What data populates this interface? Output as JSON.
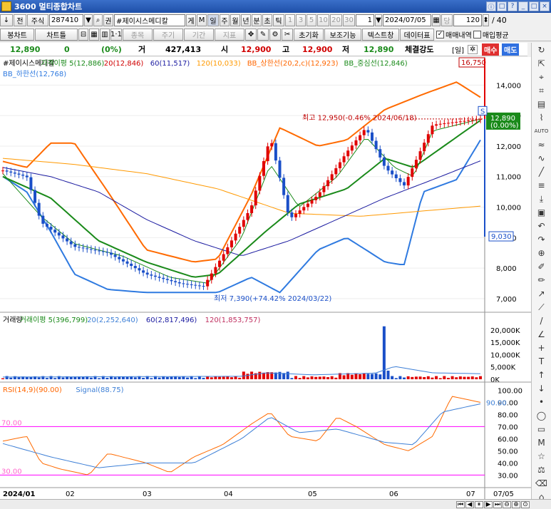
{
  "window": {
    "title": "3600 멀티종합차트",
    "controls": [
      "ⓘ",
      "□",
      "?",
      "_",
      "□",
      "×"
    ]
  },
  "toolbar1": {
    "items": [
      "↓",
      "전",
      "주식"
    ],
    "code": "287410",
    "name": "#제이시스메디칼",
    "markers": [
      "게",
      "M"
    ],
    "periods": [
      "일",
      "주",
      "월",
      "년",
      "분",
      "초",
      "틱"
    ],
    "minutes": [
      "1",
      "3",
      "5",
      "10",
      "20",
      "30"
    ],
    "interval": "1",
    "date": "2024/07/05",
    "dang": "당",
    "count": "120",
    "ratio": "/",
    "ratio2": "40"
  },
  "toolbar2": {
    "left": [
      "봉차트",
      "차트틀"
    ],
    "mid": [
      "종목",
      "주기",
      "기간",
      "지표"
    ],
    "right": [
      "초기화",
      "보조기능",
      "텍스트창",
      "데이터표"
    ],
    "checks": [
      {
        "label": "매매내역",
        "checked": true
      },
      {
        "label": "매입평균",
        "checked": false
      }
    ]
  },
  "quote": {
    "price": "12,890",
    "change": "0",
    "pct": "(0%)",
    "vol_label": "거",
    "volume": "427,413",
    "open_label": "시",
    "open": "12,900",
    "high_label": "고",
    "high": "12,900",
    "low_label": "저",
    "low": "12,890",
    "strength_label": "체결강도",
    "period_btn": "[일]",
    "buy": "매수",
    "sell": "매도"
  },
  "price_panel": {
    "legend": [
      {
        "text": "#제이시스메디칼",
        "color": "#000000"
      },
      {
        "text": "가격이평 5(12,886)",
        "color": "#1a8a1a"
      },
      {
        "text": "20(12,846)",
        "color": "#d00000"
      },
      {
        "text": "60(11,517)",
        "color": "#1a1aa0"
      },
      {
        "text": "120(10,033)",
        "color": "#ff9900"
      },
      {
        "text": "BB_상한선(20,2,c)(12,923)",
        "color": "#ff6600"
      },
      {
        "text": "BB_중심선(12,846)",
        "color": "#1a8a1a"
      }
    ],
    "legend2": "BB_하한선(12,768)",
    "high_note": "최고 12,950(-0.46% 2024/06/18)",
    "low_note": "최저 7,390(+74.42% 2024/03/22)",
    "y_ticks": [
      "14,000",
      "13,000",
      "12,000",
      "11,000",
      "10,000",
      "9,000",
      "8,000",
      "7,000"
    ],
    "last_price": "12,890",
    "last_pct": "(0.00%)",
    "top_tag": "16,750",
    "bottom_tag": "9,030",
    "s_marker": "S"
  },
  "volume_panel": {
    "legend": [
      {
        "text": "거래량",
        "color": "#000000"
      },
      {
        "text": "거래이평 5(396,799)",
        "color": "#1a8a1a"
      },
      {
        "text": "20(2,252,640)",
        "color": "#3d7fd6"
      },
      {
        "text": "60(2,817,496)",
        "color": "#1a1aa0"
      },
      {
        "text": "120(1,853,757)",
        "color": "#c03060"
      }
    ],
    "y_ticks": [
      "20,000K",
      "15,000K",
      "10,000K",
      "5,000K",
      "0K"
    ]
  },
  "rsi_panel": {
    "legend": [
      {
        "text": "RSI(14,9)(90.00)",
        "color": "#ff6600"
      },
      {
        "text": "Signal(88.75)",
        "color": "#3d7fd6"
      }
    ],
    "y_ticks": [
      "100.00",
      "90.00",
      "80.00",
      "70.00",
      "60.00",
      "50.00",
      "40.00",
      "30.00"
    ],
    "level70": "70.00",
    "level30": "30.00",
    "last_value": "90.00"
  },
  "x_axis": {
    "labels": [
      "2024/01",
      "02",
      "03",
      "04",
      "05",
      "06",
      "07"
    ],
    "end_label": "07/05"
  },
  "colors": {
    "up": "#e00000",
    "down": "#1a4fc8",
    "accent": "#1e4fa8"
  },
  "chart_data": {
    "type": "line",
    "title": "#제이시스메디칼",
    "ylim": [
      6600,
      14500
    ],
    "price_candles_approx": [
      {
        "m": "2024/01",
        "o": 11200,
        "c": 11350
      },
      {
        "m": "2024/01",
        "o": 11000,
        "c": 10800
      },
      {
        "m": "2024/01",
        "o": 9500,
        "c": 9100
      },
      {
        "m": "2024/02",
        "o": 8700,
        "c": 8500
      },
      {
        "m": "2024/02",
        "o": 8500,
        "c": 8650
      },
      {
        "m": "2024/03",
        "o": 7800,
        "c": 7500
      },
      {
        "m": "2024/03",
        "o": 7500,
        "c": 7700
      },
      {
        "m": "2024/03",
        "o": 7500,
        "c": 7390
      },
      {
        "m": "2024/04",
        "o": 8300,
        "c": 9200
      },
      {
        "m": "2024/04",
        "o": 10500,
        "c": 12400
      },
      {
        "m": "2024/04",
        "o": 10000,
        "c": 9400
      },
      {
        "m": "2024/05",
        "o": 10400,
        "c": 10800
      },
      {
        "m": "2024/05",
        "o": 12000,
        "c": 12700
      },
      {
        "m": "2024/06",
        "o": 12600,
        "c": 11600
      },
      {
        "m": "2024/06",
        "o": 11300,
        "c": 10900
      },
      {
        "m": "2024/07",
        "o": 12890,
        "c": 12890
      }
    ],
    "last": 12890,
    "high": 12950,
    "low": 7390
  }
}
